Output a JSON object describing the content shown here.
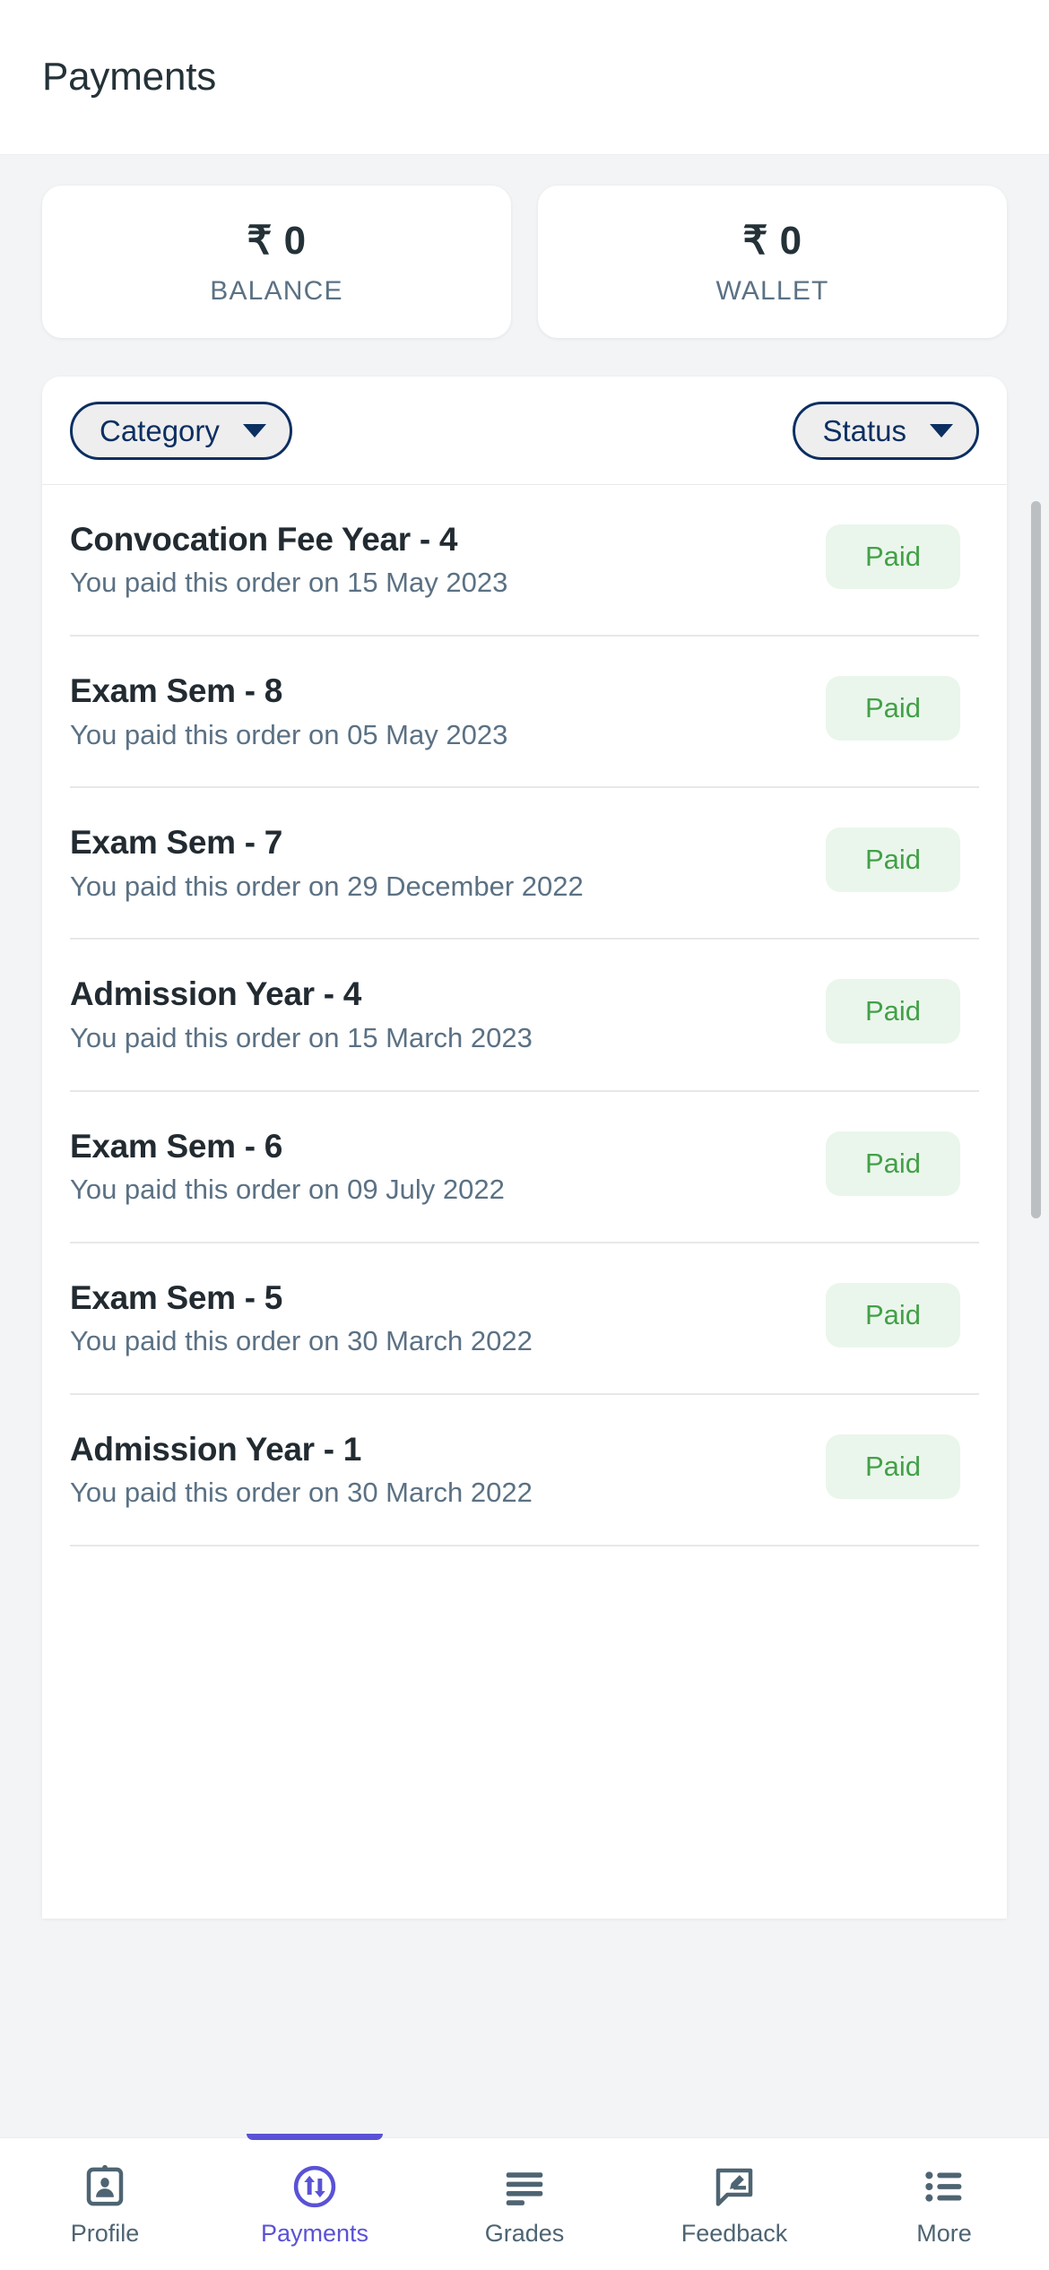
{
  "header": {
    "title": "Payments"
  },
  "summary": {
    "cards": [
      {
        "amount": "₹ 0",
        "label": "BALANCE",
        "name": "balance-card"
      },
      {
        "amount": "₹ 0",
        "label": "WALLET",
        "name": "wallet-card"
      }
    ]
  },
  "filters": {
    "category": {
      "label": "Category",
      "icon": "chevron-down-icon"
    },
    "status": {
      "label": "Status",
      "icon": "chevron-down-icon"
    }
  },
  "payments": [
    {
      "title": "Convocation Fee Year - 4",
      "subtitle": "You paid this order on 15 May 2023",
      "status": "Paid"
    },
    {
      "title": "Exam Sem - 8",
      "subtitle": "You paid this order on 05 May 2023",
      "status": "Paid"
    },
    {
      "title": "Exam Sem - 7",
      "subtitle": "You paid this order on 29 December 2022",
      "status": "Paid"
    },
    {
      "title": "Admission Year - 4",
      "subtitle": "You paid this order on 15 March 2023",
      "status": "Paid"
    },
    {
      "title": "Exam Sem - 6",
      "subtitle": "You paid this order on 09 July 2022",
      "status": "Paid"
    },
    {
      "title": "Exam Sem - 5",
      "subtitle": "You paid this order on 30 March 2022",
      "status": "Paid"
    },
    {
      "title": "Admission Year - 1",
      "subtitle": "You paid this order on 30 March 2022",
      "status": "Paid"
    }
  ],
  "bottom_nav": {
    "items": [
      {
        "label": "Profile",
        "icon": "id-badge-icon",
        "active": false
      },
      {
        "label": "Payments",
        "icon": "transfer-arrows-circle-icon",
        "active": true
      },
      {
        "label": "Grades",
        "icon": "lines-icon",
        "active": false
      },
      {
        "label": "Feedback",
        "icon": "speech-bubble-pencil-icon",
        "active": false
      },
      {
        "label": "More",
        "icon": "bulleted-list-icon",
        "active": false
      }
    ]
  },
  "colors": {
    "accent": "#5a52d5",
    "chip_border": "#0c2f61",
    "status_text": "#43a047",
    "status_bg": "#eaf6ec",
    "page_bg": "#f2f4f6",
    "title_text": "#243238",
    "muted_text": "#5b7184"
  }
}
